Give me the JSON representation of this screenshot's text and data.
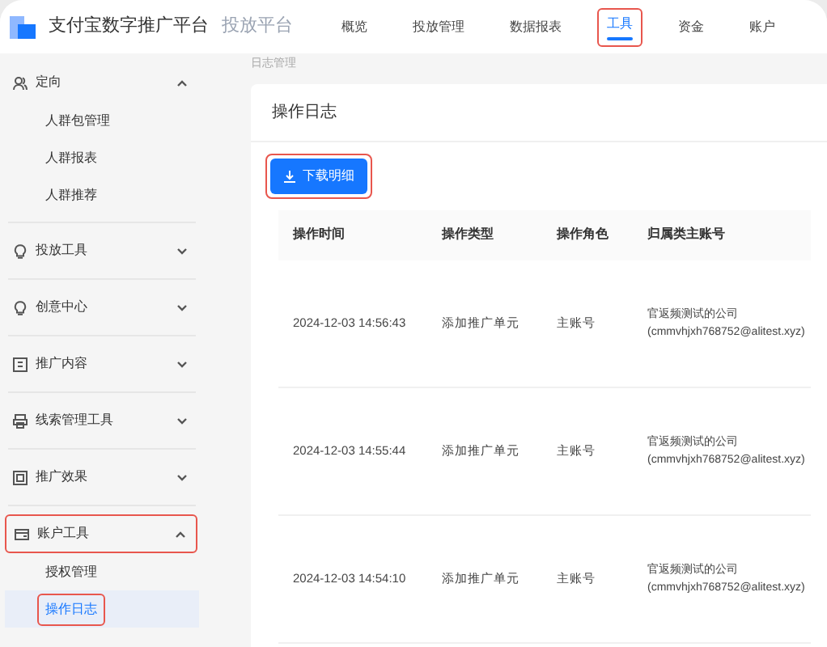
{
  "header": {
    "brand": "支付宝数字推广平台",
    "product": "投放平台",
    "nav": [
      {
        "label": "概览",
        "selected": false,
        "highlighted": false
      },
      {
        "label": "投放管理",
        "selected": false,
        "highlighted": false
      },
      {
        "label": "数据报表",
        "selected": false,
        "highlighted": false
      },
      {
        "label": "工具",
        "selected": true,
        "highlighted": true
      },
      {
        "label": "资金",
        "selected": false,
        "highlighted": false
      },
      {
        "label": "账户",
        "selected": false,
        "highlighted": false
      }
    ]
  },
  "sidebar": {
    "groups": [
      {
        "label": "定向",
        "expanded": true,
        "highlighted": false,
        "children": [
          {
            "label": "人群包管理",
            "selected": false,
            "highlighted": false
          },
          {
            "label": "人群报表",
            "selected": false,
            "highlighted": false
          },
          {
            "label": "人群推荐",
            "selected": false,
            "highlighted": false
          }
        ]
      },
      {
        "label": "投放工具",
        "expanded": false,
        "highlighted": false
      },
      {
        "label": "创意中心",
        "expanded": false,
        "highlighted": false
      },
      {
        "label": "推广内容",
        "expanded": false,
        "highlighted": false
      },
      {
        "label": "线索管理工具",
        "expanded": false,
        "highlighted": false
      },
      {
        "label": "推广效果",
        "expanded": false,
        "highlighted": false
      },
      {
        "label": "账户工具",
        "expanded": true,
        "highlighted": true,
        "children": [
          {
            "label": "授权管理",
            "selected": false,
            "highlighted": false
          },
          {
            "label": "操作日志",
            "selected": true,
            "highlighted": true
          }
        ]
      }
    ]
  },
  "breadcrumb": "日志管理",
  "card": {
    "title": "操作日志",
    "download_button": {
      "label": "下载明细",
      "highlighted": true
    },
    "table": {
      "columns": [
        "操作时间",
        "操作类型",
        "操作角色",
        "归属类主账号"
      ],
      "rows": [
        [
          "2024-12-03 14:56:43",
          "添加推广单元",
          "主账号",
          "官返频测试的公司",
          "(cmmvhjxh768752@alitest.xyz)"
        ],
        [
          "2024-12-03 14:55:44",
          "添加推广单元",
          "主账号",
          "官返频测试的公司",
          "(cmmvhjxh768752@alitest.xyz)"
        ],
        [
          "2024-12-03 14:54:10",
          "添加推广单元",
          "主账号",
          "官返频测试的公司",
          "(cmmvhjxh768752@alitest.xyz)"
        ]
      ]
    }
  }
}
